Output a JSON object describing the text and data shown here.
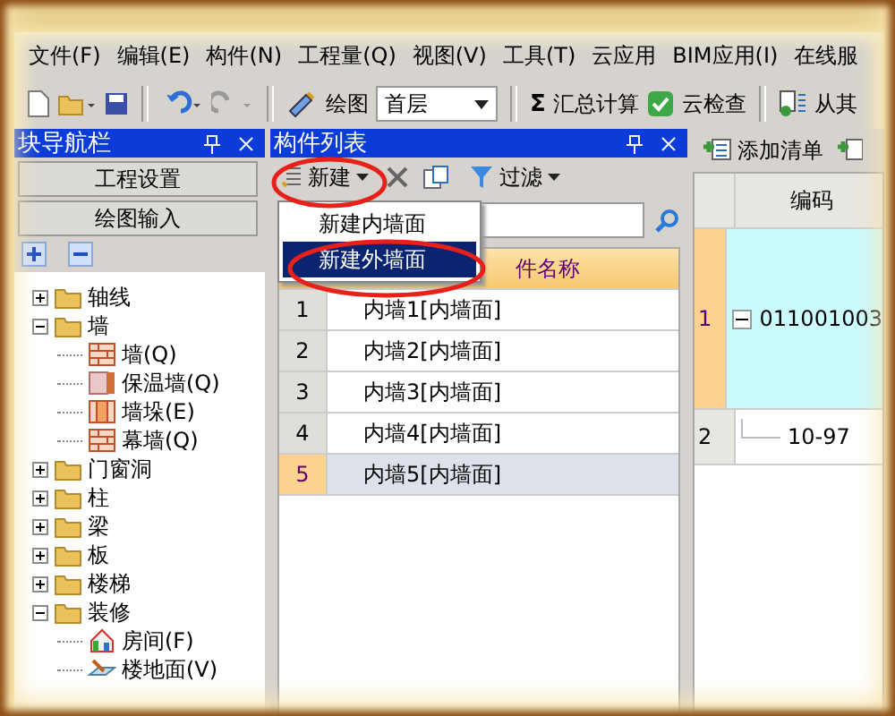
{
  "menu": [
    "文件(F)",
    "编辑(E)",
    "构件(N)",
    "工程量(Q)",
    "视图(V)",
    "工具(T)",
    "云应用",
    "BIM应用(I)",
    "在线服"
  ],
  "toolbar": {
    "draw_label": "绘图",
    "floor": "首层",
    "sum_icon": "Σ",
    "sum_label": "汇总计算",
    "check_label": "云检查",
    "from_label": "从其"
  },
  "nav_panel": {
    "title": "块导航栏",
    "buttons": [
      "工程设置",
      "绘图输入"
    ],
    "tree": [
      {
        "label": "轴线",
        "kind": "folder",
        "expanded": false
      },
      {
        "label": "墙",
        "kind": "folder",
        "expanded": true,
        "children": [
          {
            "label": "墙(Q)",
            "kind": "wall"
          },
          {
            "label": "保温墙(Q)",
            "kind": "insulation"
          },
          {
            "label": "墙垛(E)",
            "kind": "pier"
          },
          {
            "label": "幕墙(Q)",
            "kind": "wall"
          }
        ]
      },
      {
        "label": "门窗洞",
        "kind": "folder",
        "expanded": false
      },
      {
        "label": "柱",
        "kind": "folder",
        "expanded": false
      },
      {
        "label": "梁",
        "kind": "folder",
        "expanded": false
      },
      {
        "label": "板",
        "kind": "folder",
        "expanded": false
      },
      {
        "label": "楼梯",
        "kind": "folder",
        "expanded": false
      },
      {
        "label": "装修",
        "kind": "folder",
        "expanded": true,
        "children": [
          {
            "label": "房间(F)",
            "kind": "room"
          },
          {
            "label": "楼地面(V)",
            "kind": "floor"
          }
        ]
      }
    ]
  },
  "component_list": {
    "title": "构件列表",
    "new_button": "新建",
    "filter_button": "过滤",
    "new_menu": [
      {
        "label": "新建内墙面",
        "selected": false
      },
      {
        "label": "新建外墙面",
        "selected": true
      }
    ],
    "column_header": "件名称",
    "rows": [
      {
        "index": "1",
        "name": "内墙1[内墙面]",
        "selected": false
      },
      {
        "index": "2",
        "name": "内墙2[内墙面]",
        "selected": false
      },
      {
        "index": "3",
        "name": "内墙3[内墙面]",
        "selected": false
      },
      {
        "index": "4",
        "name": "内墙4[内墙面]",
        "selected": false
      },
      {
        "index": "5",
        "name": "内墙5[内墙面]",
        "selected": true
      }
    ]
  },
  "bill_panel": {
    "add_button": "添加清单",
    "column_header": "编码",
    "rows": [
      {
        "index": "1",
        "code": "011001003",
        "selected": true,
        "expanded": true
      },
      {
        "index": "2",
        "code": "10-97",
        "selected": false
      }
    ]
  }
}
